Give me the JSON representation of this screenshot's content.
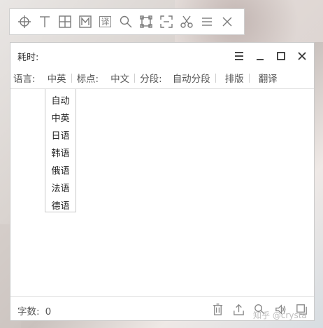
{
  "toolbar": {
    "buttons": [
      {
        "name": "crosshair-icon"
      },
      {
        "name": "text-tool-icon",
        "glyph": "T"
      },
      {
        "name": "table-grid-icon"
      },
      {
        "name": "markdown-m-icon",
        "glyph": "M"
      },
      {
        "name": "translate-icon",
        "glyph": "译"
      },
      {
        "name": "search-icon"
      },
      {
        "name": "select-region-icon"
      },
      {
        "name": "capture-frame-icon"
      },
      {
        "name": "scissors-icon"
      },
      {
        "name": "menu-icon"
      },
      {
        "name": "close-icon"
      }
    ]
  },
  "window": {
    "elapsed_label": "耗时:",
    "options": {
      "language_label": "语言:",
      "language_value": "中英",
      "punct_label": "标点:",
      "punct_value": "中文",
      "segment_label": "分段:",
      "segment_value": "自动分段",
      "layout_label": "排版",
      "translate_label": "翻译"
    },
    "language_dropdown": [
      "自动",
      "中英",
      "日语",
      "韩语",
      "俄语",
      "法语",
      "德语"
    ],
    "status": {
      "count_label": "字数:",
      "count_value": "0"
    }
  },
  "watermark": "知乎 @crysta"
}
